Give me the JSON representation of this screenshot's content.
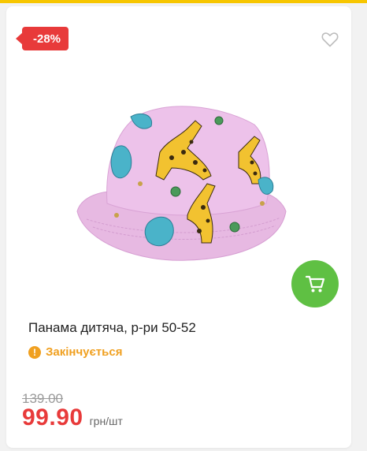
{
  "product": {
    "discount_badge": "-28%",
    "title": "Панама дитяча, р-ри 50-52",
    "status": "Закінчується",
    "old_price": "139.00",
    "price": "99.90",
    "unit": "грн/шт"
  },
  "icons": {
    "favorite": "heart-outline-icon",
    "cart": "cart-icon",
    "status": "exclamation-icon"
  },
  "colors": {
    "accent_red": "#e83a3a",
    "cart_green": "#5fc043",
    "status_orange": "#f0a020",
    "top_strip": "#f7c600"
  }
}
